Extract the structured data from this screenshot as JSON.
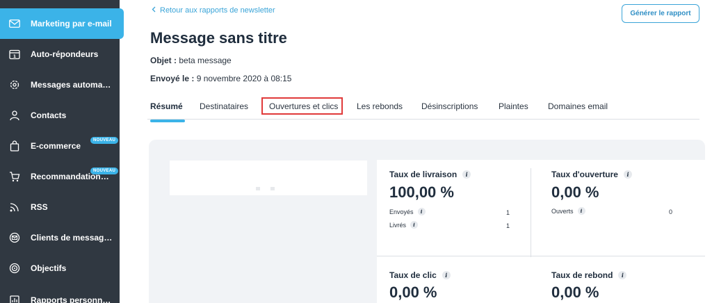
{
  "sidebar": {
    "items": [
      {
        "label": "Marketing par e-mail",
        "icon": "envelope-icon",
        "active": true
      },
      {
        "label": "Auto-répondeurs",
        "icon": "calendar-icon"
      },
      {
        "label": "Messages automatisés",
        "icon": "gear-icon"
      },
      {
        "label": "Contacts",
        "icon": "person-icon"
      },
      {
        "label": "E-commerce",
        "icon": "shopping-bag-icon",
        "badge": "NOUVEAU"
      },
      {
        "label": "Recommandations de …",
        "icon": "cart-icon",
        "badge": "NOUVEAU"
      },
      {
        "label": "RSS",
        "icon": "rss-icon"
      },
      {
        "label": "Clients de messagerie",
        "icon": "mail-client-icon"
      },
      {
        "label": "Objectifs",
        "icon": "target-icon"
      },
      {
        "label": "Rapports personnalisés",
        "icon": "report-icon"
      }
    ]
  },
  "header": {
    "back_link": "Retour aux rapports de newsletter",
    "generate_button": "Générer le rapport",
    "title": "Message sans titre",
    "subject_label": "Objet :",
    "subject_value": "beta message",
    "sent_label": "Envoyé le :",
    "sent_value": "9 novembre 2020 à 08:15"
  },
  "tabs": [
    {
      "label": "Résumé",
      "active": true
    },
    {
      "label": "Destinataires"
    },
    {
      "label": "Ouvertures et clics",
      "highlighted": true
    },
    {
      "label": "Les rebonds"
    },
    {
      "label": "Désinscriptions"
    },
    {
      "label": "Plaintes"
    },
    {
      "label": "Domaines email"
    }
  ],
  "stats": {
    "delivery": {
      "title": "Taux de livraison",
      "value": "100,00 %",
      "rows": [
        {
          "label": "Envoyés",
          "value": "1"
        },
        {
          "label": "Livrés",
          "value": "1"
        }
      ]
    },
    "open": {
      "title": "Taux d'ouverture",
      "value": "0,00 %",
      "rows": [
        {
          "label": "Ouverts",
          "value": "0"
        }
      ]
    },
    "click": {
      "title": "Taux de clic",
      "value": "0,00 %"
    },
    "bounce": {
      "title": "Taux de rebond",
      "value": "0,00 %"
    }
  },
  "colors": {
    "sidebar_bg": "#303841",
    "accent": "#3bb3e8",
    "highlight_box": "#e03a3a"
  }
}
